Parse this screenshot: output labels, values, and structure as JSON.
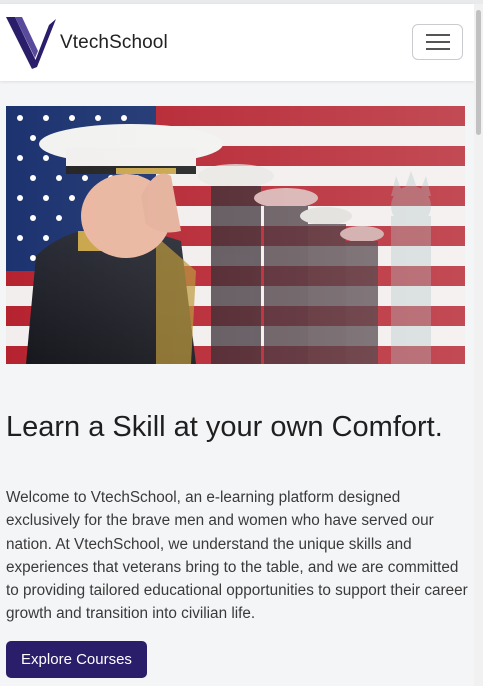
{
  "navbar": {
    "brand_name": "VtechSchool",
    "logo_icon": "v-logo-icon",
    "menu_icon": "hamburger-menu-icon"
  },
  "hero": {
    "image_description": "saluting military officer in front of American flag"
  },
  "content": {
    "headline": "Learn a Skill at your own Comfort.",
    "intro": "Welcome to VtechSchool, an e-learning platform designed exclusively for the brave men and women who have served our nation. At VtechSchool, we understand the unique skills and experiences that veterans bring to the table, and we are committed to providing tailored educational opportunities to support their career growth and transition into civilian life.",
    "cta_label": "Explore Courses"
  },
  "colors": {
    "brand": "#2a1d6a",
    "page_background": "#f4f5f7",
    "navbar_background": "#ffffff"
  }
}
